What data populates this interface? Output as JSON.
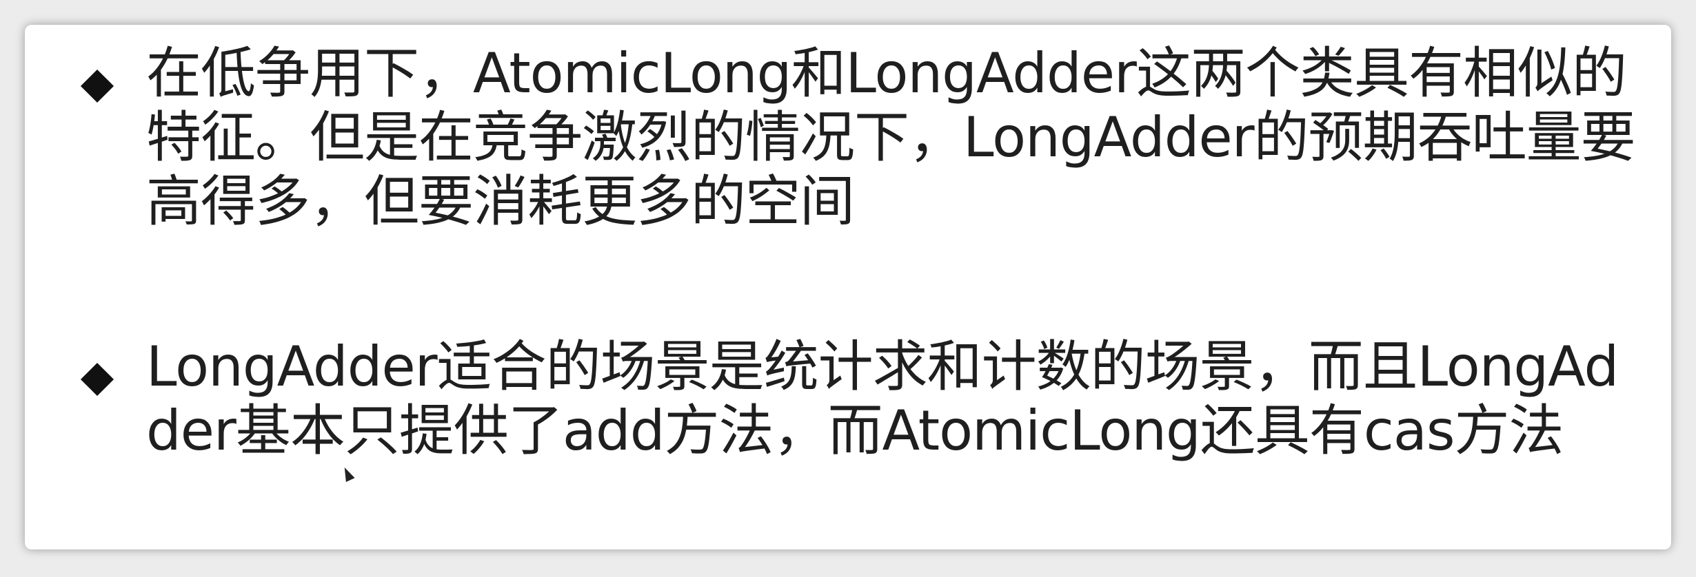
{
  "slide": {
    "bullets": [
      {
        "text": "在低争用下，AtomicLong和LongAdder这两个类具有相似的特征。但是在竞争激烈的情况下，LongAdder的预期吞吐量要高得多，但要消耗更多的空间"
      },
      {
        "text": "LongAdder适合的场景是统计求和计数的场景，而且LongAdder基本只提供了add方法，而AtomicLong还具有cas方法"
      }
    ]
  }
}
